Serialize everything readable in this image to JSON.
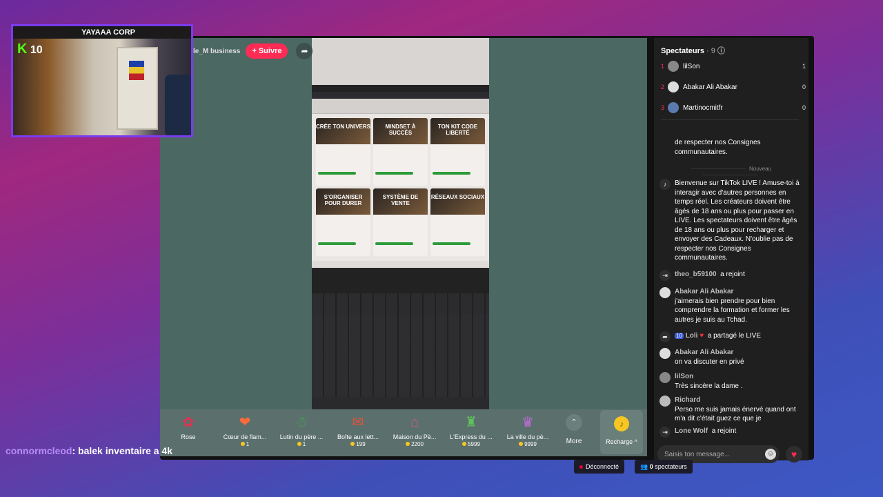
{
  "webcam": {
    "title": "YAYAAA CORP",
    "badge_k": "K",
    "badge_number": "10"
  },
  "stream": {
    "streamer_name": "le_M business",
    "follow_label": "+ Suivre"
  },
  "laptop_cards": [
    {
      "title": "CRÉE TON UNIVERS"
    },
    {
      "title": "MINDSET À SUCCÈS"
    },
    {
      "title": "TON KIT CODE LIBERTÉ"
    },
    {
      "title": "S'ORGANISER POUR DURER"
    },
    {
      "title": "SYSTÈME DE VENTE"
    },
    {
      "title": "RÉSEAUX SOCIAUX"
    }
  ],
  "gifts": [
    {
      "name": "Rose",
      "price": ""
    },
    {
      "name": "Cœur de flam...",
      "price": "1"
    },
    {
      "name": "Lutin du père ...",
      "price": "1"
    },
    {
      "name": "Boîte aux lett...",
      "price": "199"
    },
    {
      "name": "Maison du Pè...",
      "price": "2200"
    },
    {
      "name": "L'Express du ...",
      "price": "5999"
    },
    {
      "name": "La ville du pè...",
      "price": "9999"
    }
  ],
  "more_label": "More",
  "recharge_label": "Recharge ^",
  "sidebar": {
    "title": "Spectateurs",
    "count": "· 9",
    "viewers": [
      {
        "rank": "1",
        "name": "lilSon",
        "score": "1"
      },
      {
        "rank": "2",
        "name": "Abakar Ali Abakar",
        "score": "0"
      },
      {
        "rank": "3",
        "name": "Martinocmitfr",
        "score": "0"
      }
    ],
    "old_msg_tail": "de respecter nos Consignes communautaires.",
    "new_label": "Nouveau",
    "welcome_msg": "Bienvenue sur TikTok LIVE ! Amuse-toi à interagir avec d'autres personnes en temps réel. Les créateurs doivent être âgés de 18 ans ou plus pour passer en LIVE. Les spectateurs doivent être âgés de 18 ans ou plus pour recharger et envoyer des Cadeaux. N'oublie pas de respecter nos Consignes communautaires.",
    "messages": [
      {
        "user": "theo_b59100",
        "text": "a rejoint"
      },
      {
        "user": "Abakar Ali Abakar",
        "text": "j'aimerais bien prendre pour bien comprendre la formation et former les autres je suis au Tchad."
      },
      {
        "user": "Loli",
        "badge": "10",
        "text": "a partagé le LIVE"
      },
      {
        "user": "Abakar Ali Abakar",
        "text": "on va discuter en privé"
      },
      {
        "user": "lilSon",
        "text": "Très sincère la dame ."
      },
      {
        "user": "Richard",
        "text": "Perso me suis jamais énervé quand ont m'a dit c'était guez ce que je"
      },
      {
        "user": "Lone Wolf",
        "text": "a rejoint"
      }
    ],
    "input_placeholder": "Saisis ton message..."
  },
  "overlay_chat": {
    "user": "connormcleod",
    "text": ": balek inventaire a 4k"
  },
  "status": {
    "connection": "Déconnecté",
    "viewers_count": "0",
    "viewers_label": "spectateurs"
  },
  "colors": {
    "accent": "#fe2c55",
    "kick_green": "#53fc18",
    "video_bg": "#4c6863"
  }
}
